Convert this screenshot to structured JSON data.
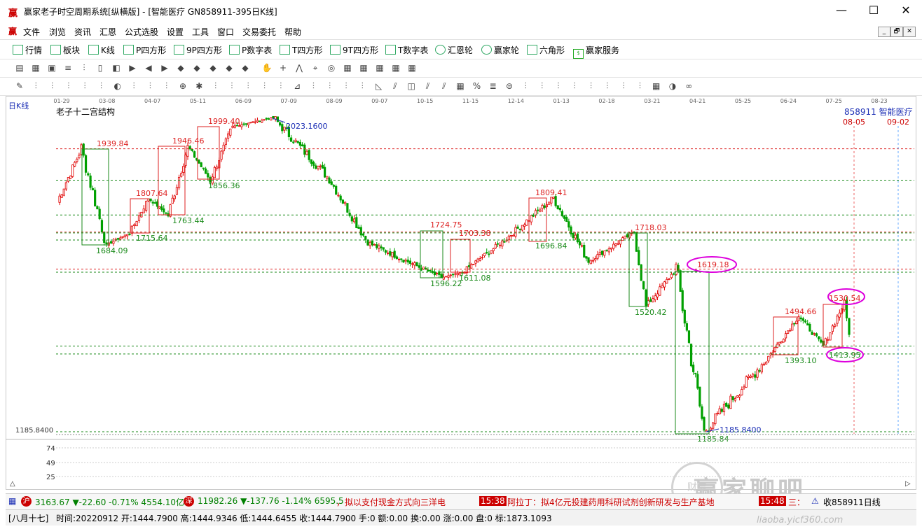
{
  "window": {
    "title": "赢家老子时空周期系统[纵横版] - [智能医疗   GN858911-395日K线]",
    "icon": "赢",
    "minimize": "—",
    "maximize": "☐",
    "close": "✕"
  },
  "menu": {
    "items": [
      "文件",
      "浏览",
      "资讯",
      "汇恩",
      "公式选股",
      "设置",
      "工具",
      "窗口",
      "交易委托",
      "帮助"
    ],
    "mdi": [
      "_",
      "🗗",
      "✕"
    ]
  },
  "toolbar": {
    "items": [
      {
        "icon": "grid-icon",
        "label": "行情"
      },
      {
        "icon": "block-icon",
        "label": "板块"
      },
      {
        "icon": "candle-icon",
        "label": "K线"
      },
      {
        "icon": "ps-icon",
        "label": "P四方形"
      },
      {
        "icon": "p9-icon",
        "label": "9P四方形"
      },
      {
        "icon": "pn-icon",
        "label": "P数字表"
      },
      {
        "icon": "ts-icon",
        "label": "T四方形"
      },
      {
        "icon": "t9-icon",
        "label": "9T四方形"
      },
      {
        "icon": "tn-icon",
        "label": "T数字表"
      },
      {
        "icon": "wheel-icon",
        "label": "汇恩轮"
      },
      {
        "icon": "wheel2-icon",
        "label": "赢家轮"
      },
      {
        "icon": "hexagon-icon",
        "label": "六角形"
      },
      {
        "icon": "dollar-icon",
        "label": "赢家服务"
      }
    ]
  },
  "chart": {
    "period": "日K线",
    "name": "老子十二宫结构",
    "code": "858911",
    "stock_name": "智能医疗",
    "date_marker_a": "08-05",
    "date_marker_b": "09-02",
    "price_low_label": "1185.8400",
    "peak_label": "2023.1600",
    "trough_label": "1185.8400",
    "sub_ticks": [
      "74",
      "49",
      "25"
    ],
    "bottom_button": "△",
    "scroll_button": "▷"
  },
  "chart_data": {
    "type": "candlestick",
    "x_ticks": [
      "01-29",
      "03-08",
      "04-07",
      "05-11",
      "06-09",
      "07-09",
      "08-09",
      "09-07",
      "10-15",
      "11-15",
      "12-14",
      "01-13",
      "02-18",
      "03-21",
      "04-21",
      "05-25",
      "06-24",
      "07-25",
      "08-23"
    ],
    "ylim": [
      1185.84,
      2023.16
    ],
    "price_labels": [
      {
        "text": "1939.84",
        "color": "red"
      },
      {
        "text": "1684.09",
        "color": "green"
      },
      {
        "text": "1807.64",
        "color": "red"
      },
      {
        "text": "1715.64",
        "color": "green"
      },
      {
        "text": "1946.46",
        "color": "red"
      },
      {
        "text": "1763.44",
        "color": "green"
      },
      {
        "text": "1999.40",
        "color": "red"
      },
      {
        "text": "1856.36",
        "color": "green"
      },
      {
        "text": "1724.75",
        "color": "red"
      },
      {
        "text": "1596.22",
        "color": "green"
      },
      {
        "text": "1703.38",
        "color": "red"
      },
      {
        "text": "1611.08",
        "color": "green"
      },
      {
        "text": "1809.41",
        "color": "red"
      },
      {
        "text": "1696.84",
        "color": "green"
      },
      {
        "text": "1718.03",
        "color": "red"
      },
      {
        "text": "1520.42",
        "color": "green"
      },
      {
        "text": "1619.18",
        "color": "red"
      },
      {
        "text": "1185.84",
        "color": "green"
      },
      {
        "text": "1494.66",
        "color": "red"
      },
      {
        "text": "1393.10",
        "color": "green"
      },
      {
        "text": "1530.54",
        "color": "red"
      },
      {
        "text": "1413.95",
        "color": "green"
      }
    ],
    "anchor_points": [
      {
        "date": "01-29",
        "close": 1800
      },
      {
        "date": "02-20",
        "close": 1939.84
      },
      {
        "date": "03-08",
        "close": 1684.09
      },
      {
        "date": "03-25",
        "close": 1715.64
      },
      {
        "date": "04-07",
        "close": 1807.64
      },
      {
        "date": "04-20",
        "close": 1763.44
      },
      {
        "date": "05-11",
        "close": 1946.46
      },
      {
        "date": "05-25",
        "close": 1856.36
      },
      {
        "date": "06-09",
        "close": 1999.4
      },
      {
        "date": "07-09",
        "close": 2023.16
      },
      {
        "date": "08-09",
        "close": 1860
      },
      {
        "date": "09-07",
        "close": 1690
      },
      {
        "date": "10-15",
        "close": 1596.22
      },
      {
        "date": "11-15",
        "close": 1611.08
      },
      {
        "date": "12-14",
        "close": 1696.84
      },
      {
        "date": "01-13",
        "close": 1809.41
      },
      {
        "date": "02-18",
        "close": 1640
      },
      {
        "date": "03-21",
        "close": 1718.03
      },
      {
        "date": "03-28",
        "close": 1520.42
      },
      {
        "date": "04-21",
        "close": 1619.18
      },
      {
        "date": "04-27",
        "close": 1185.84
      },
      {
        "date": "06-24",
        "close": 1393.1
      },
      {
        "date": "07-10",
        "close": 1494.66
      },
      {
        "date": "07-25",
        "close": 1413.95
      },
      {
        "date": "08-05",
        "close": 1530.54
      },
      {
        "date": "09-12",
        "close": 1444.79
      }
    ]
  },
  "status": {
    "sh_label": "沪",
    "sh_value": "3163.67 ▼-22.60 -0.71% 4554.10亿",
    "sz_label": "深",
    "sz_value": "11982.26 ▼-137.76 -1.14% 6595.5",
    "news1": "，拟以支付现金方式向三洋电",
    "time1": "15:38",
    "news2": "阿拉丁：拟4亿元投建药用科研试剂创新研发与生产基地",
    "time2": "15:48",
    "news3": "三：",
    "right_label": "收858911日线"
  },
  "infobar": {
    "lunar": "[八月十七]",
    "text": "时间:20220912 开:1444.7900 高:1444.9346 低:1444.6455 收:1444.7900 手:0 额:0.00 换:0.00 涨:0.00 盘:0 标:1873.1093"
  },
  "watermark": {
    "brand": "赢家聊吧",
    "url": "liaoba.yicf360.com",
    "seal": "财赢"
  }
}
